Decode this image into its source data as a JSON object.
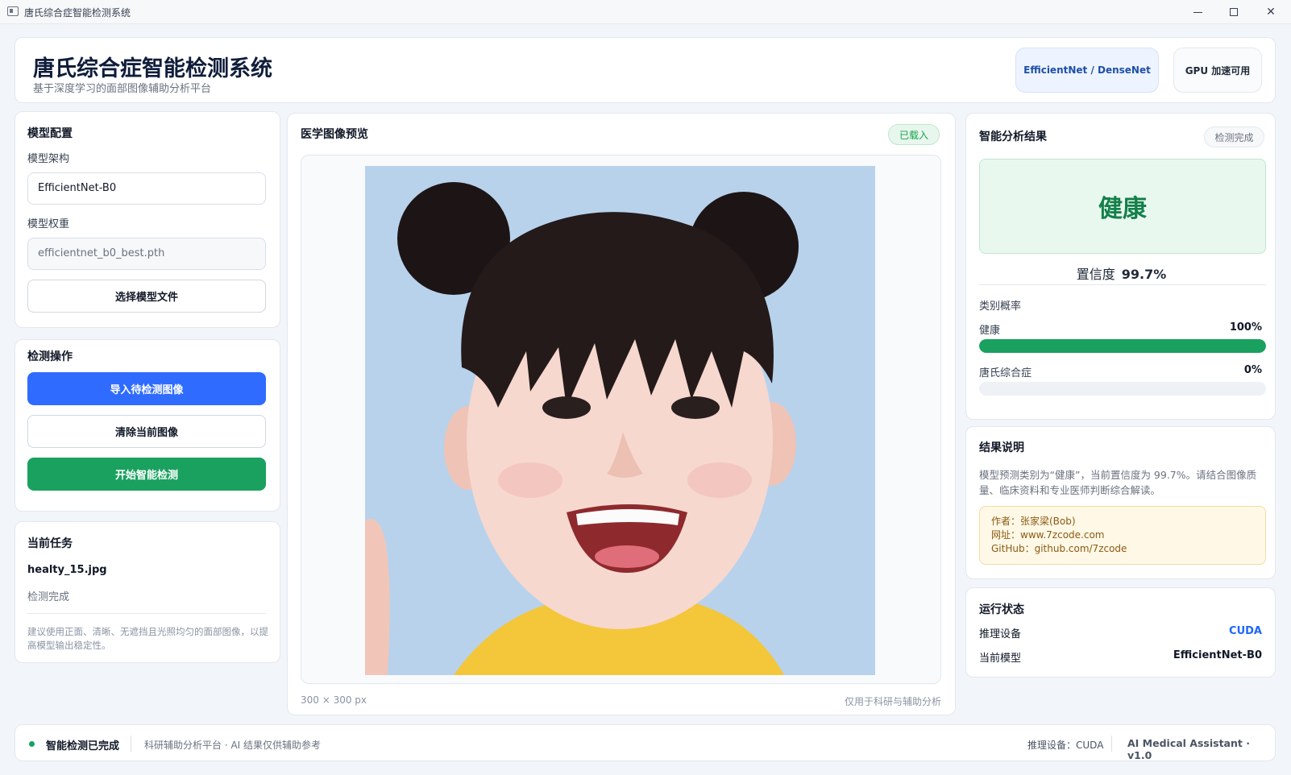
{
  "window": {
    "title": "唐氏综合症智能检测系统"
  },
  "header": {
    "title": "唐氏综合症智能检测系统",
    "subtitle": "基于深度学习的面部图像辅助分析平台",
    "model_chip": "EfficientNet / DenseNet",
    "gpu_chip": "GPU 加速可用"
  },
  "config": {
    "title": "模型配置",
    "arch_label": "模型架构",
    "arch_value": "EfficientNet-B0",
    "weight_label": "模型权重",
    "weight_value": "efficientnet_b0_best.pth",
    "choose_button": "选择模型文件"
  },
  "ops": {
    "title": "检测操作",
    "import_button": "导入待检测图像",
    "clear_button": "清除当前图像",
    "start_button": "开始智能检测"
  },
  "task": {
    "title": "当前任务",
    "filename": "healty_15.jpg",
    "status": "检测完成",
    "tip": "建议使用正面、清晰、无遮挡且光照均匀的面部图像，以提高模型输出稳定性。"
  },
  "preview": {
    "title": "医学图像预览",
    "badge": "已载入",
    "size_text": "300 × 300 px",
    "disclaimer": "仅用于科研与辅助分析"
  },
  "result": {
    "title": "智能分析结果",
    "badge": "检测完成",
    "label": "健康",
    "confidence_label": "置信度",
    "confidence_value": "99.7%",
    "prob_title": "类别概率",
    "classes": [
      {
        "name": "健康",
        "value_text": "100%",
        "fraction": 1.0
      },
      {
        "name": "唐氏综合症",
        "value_text": "0%",
        "fraction": 0.0
      }
    ]
  },
  "note": {
    "title": "结果说明",
    "text": "模型预测类别为“健康”，当前置信度为 99.7%。请结合图像质量、临床资料和专业医师判断综合解读。",
    "author": "作者：张家梁(Bob)",
    "site": "网址：www.7zcode.com",
    "github": "GitHub：github.com/7zcode"
  },
  "run": {
    "title": "运行状态",
    "device_label": "推理设备",
    "device_value": "CUDA",
    "model_label": "当前模型",
    "model_value": "EfficientNet-B0"
  },
  "statusbar": {
    "main": "智能检测已完成",
    "sub": "科研辅助分析平台 · AI 结果仅供辅助参考",
    "device": "推理设备：CUDA",
    "app": "AI Medical Assistant  ·  v1.0"
  },
  "colors": {
    "primary_blue": "#2f6bff",
    "success_green": "#1aa15f",
    "result_green": "#14804a",
    "cuda_blue": "#1e66ff"
  }
}
